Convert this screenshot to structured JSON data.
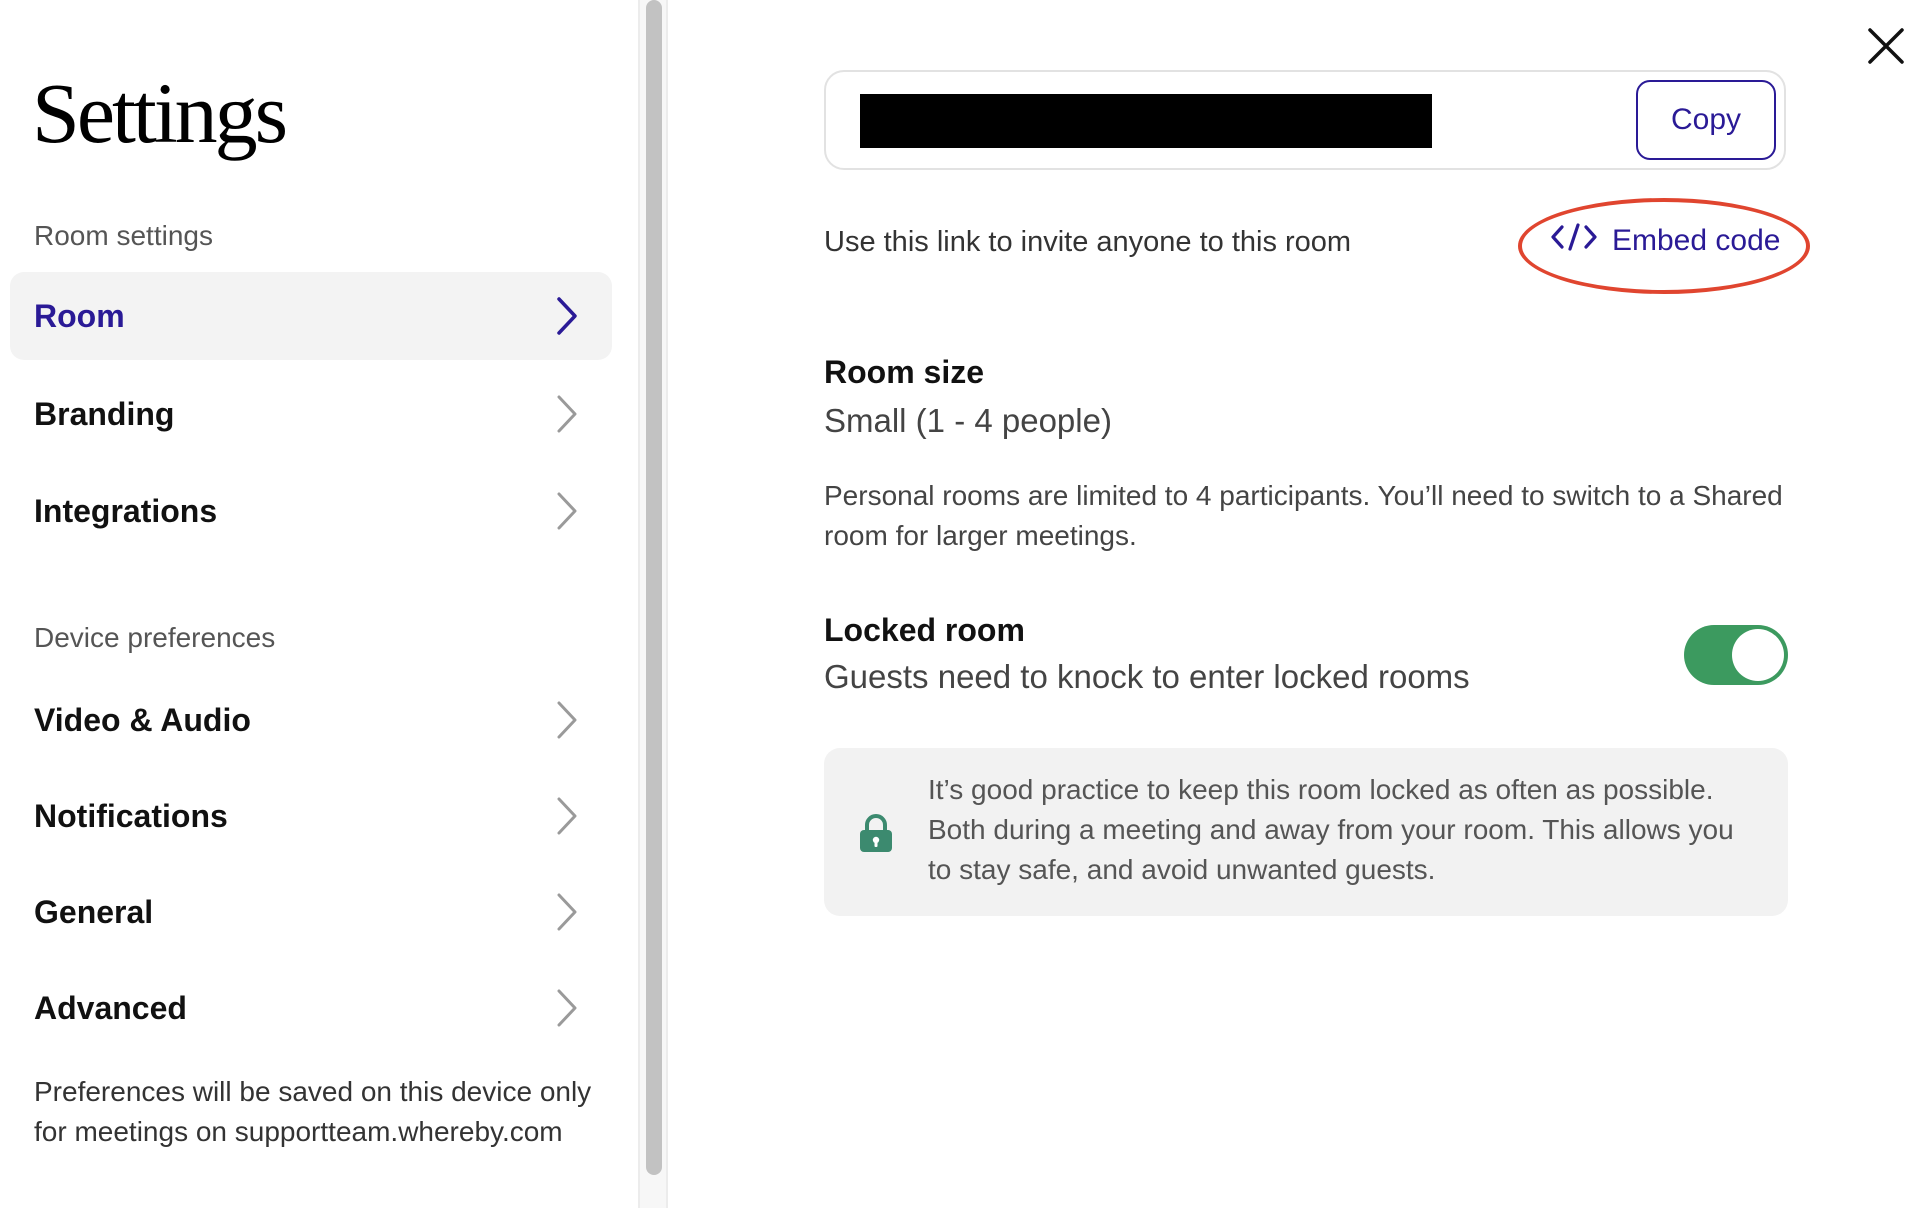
{
  "sidebar": {
    "title": "Settings",
    "sections": {
      "room_settings_label": "Room settings",
      "device_preferences_label": "Device preferences"
    },
    "items": [
      {
        "label": "Room",
        "active": true
      },
      {
        "label": "Branding",
        "active": false
      },
      {
        "label": "Integrations",
        "active": false
      },
      {
        "label": "Video & Audio",
        "active": false
      },
      {
        "label": "Notifications",
        "active": false
      },
      {
        "label": "General",
        "active": false
      },
      {
        "label": "Advanced",
        "active": false
      }
    ],
    "footer_note": "Preferences will be saved on this device only for meetings on supportteam.whereby.com"
  },
  "main": {
    "room_link": {
      "value": "",
      "copy_label": "Copy"
    },
    "invite_text": "Use this link to invite anyone to this room",
    "embed_code_label": "Embed code",
    "room_size": {
      "title": "Room size",
      "value": "Small (1 - 4 people)",
      "note": "Personal rooms are limited to 4 participants. You’ll need to switch to a Shared room for larger meetings."
    },
    "locked_room": {
      "title": "Locked room",
      "description": "Guests need to knock to enter locked rooms",
      "enabled": true
    },
    "info_box": {
      "text": "It’s good practice to keep this room locked as often as possible. Both during a meeting and away from your room. This allows you to stay safe, and avoid unwanted guests."
    }
  },
  "colors": {
    "accent": "#2a1a96",
    "toggle_on": "#3c9a5f",
    "highlight": "#e0452f",
    "lock_icon": "#3c8a6f"
  },
  "icons": {
    "chevron": "chevron-right-icon",
    "close": "close-icon",
    "embed": "code-icon",
    "lock": "lock-icon"
  }
}
